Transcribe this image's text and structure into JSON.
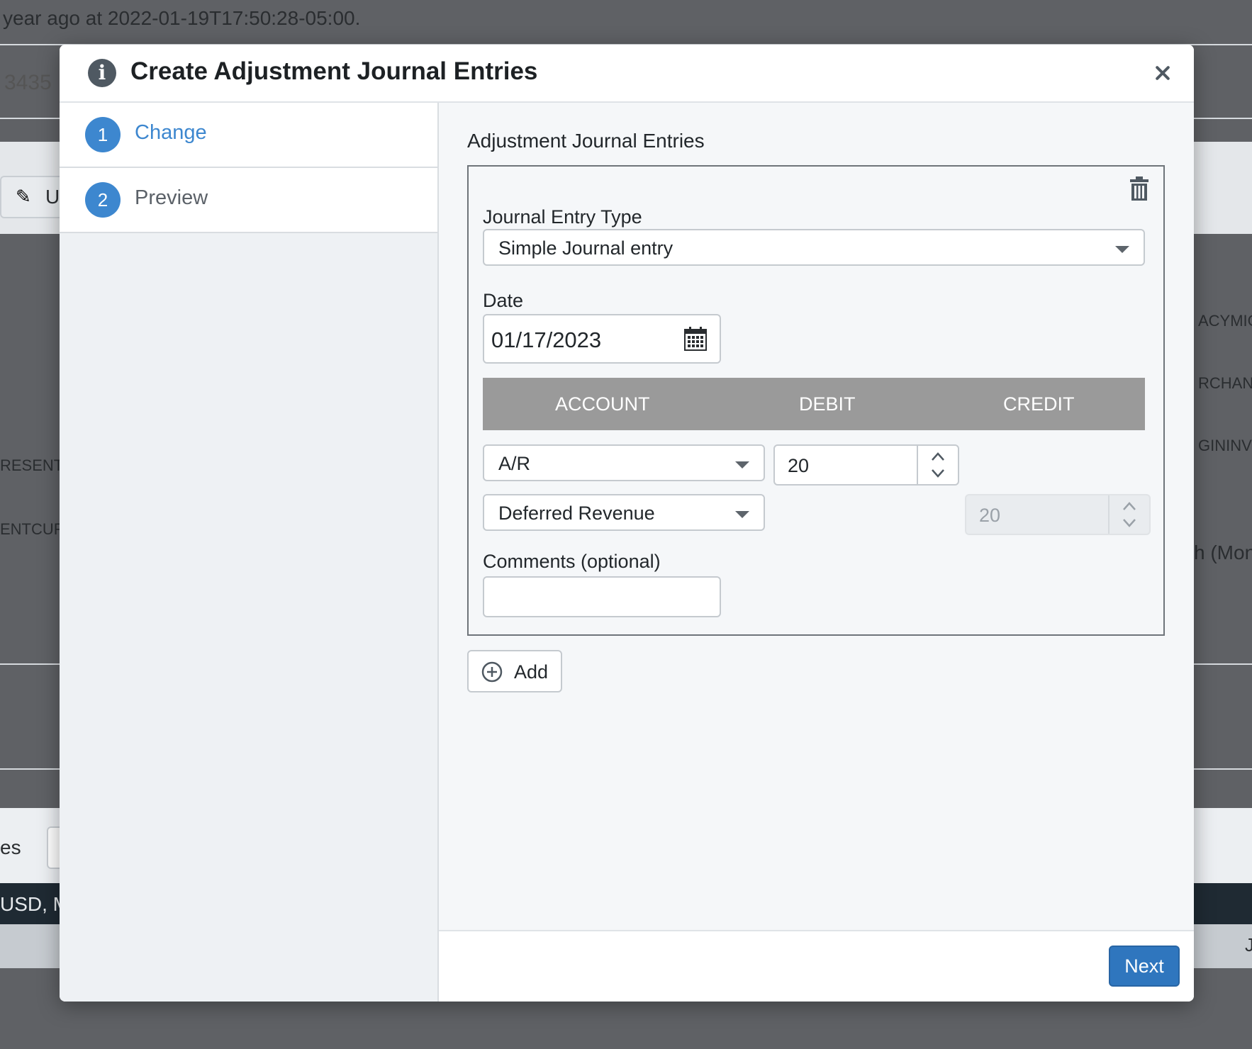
{
  "background": {
    "top_text": "year ago at 2022-01-19T17:50:28-05:00.",
    "id_fragment": "3435",
    "button_fragment": "U",
    "labels": {
      "legacymig": "ACYMIG",
      "merchant": "RCHANT",
      "origininv": "GININVO",
      "present": "RESENTN",
      "entcurr": "ENTCURF",
      "month": "h (Mont",
      "es": "es",
      "currency": "USD, M",
      "right_j": "J"
    }
  },
  "modal": {
    "title": "Create Adjustment Journal Entries",
    "steps": [
      {
        "number": "1",
        "label": "Change"
      },
      {
        "number": "2",
        "label": "Preview"
      }
    ],
    "section_title": "Adjustment Journal Entries",
    "journal_entry_type": {
      "label": "Journal Entry Type",
      "value": "Simple Journal entry"
    },
    "date": {
      "label": "Date",
      "value": "01/17/2023"
    },
    "table": {
      "headers": [
        "ACCOUNT",
        "DEBIT",
        "CREDIT"
      ],
      "rows": [
        {
          "account": "A/R",
          "debit": "20",
          "credit": ""
        },
        {
          "account": "Deferred Revenue",
          "debit": "",
          "credit": "20"
        }
      ]
    },
    "comments": {
      "label": "Comments (optional)",
      "value": ""
    },
    "add_label": "Add",
    "next_label": "Next"
  },
  "colors": {
    "accent": "#3d87cf",
    "primary_button": "#2f76be",
    "grid_header": "#9a9a9a"
  },
  "icons": {
    "info": "info-icon",
    "close": "close-icon",
    "trash": "trash-icon",
    "calendar": "calendar-icon",
    "plus": "plus-circle-icon"
  }
}
